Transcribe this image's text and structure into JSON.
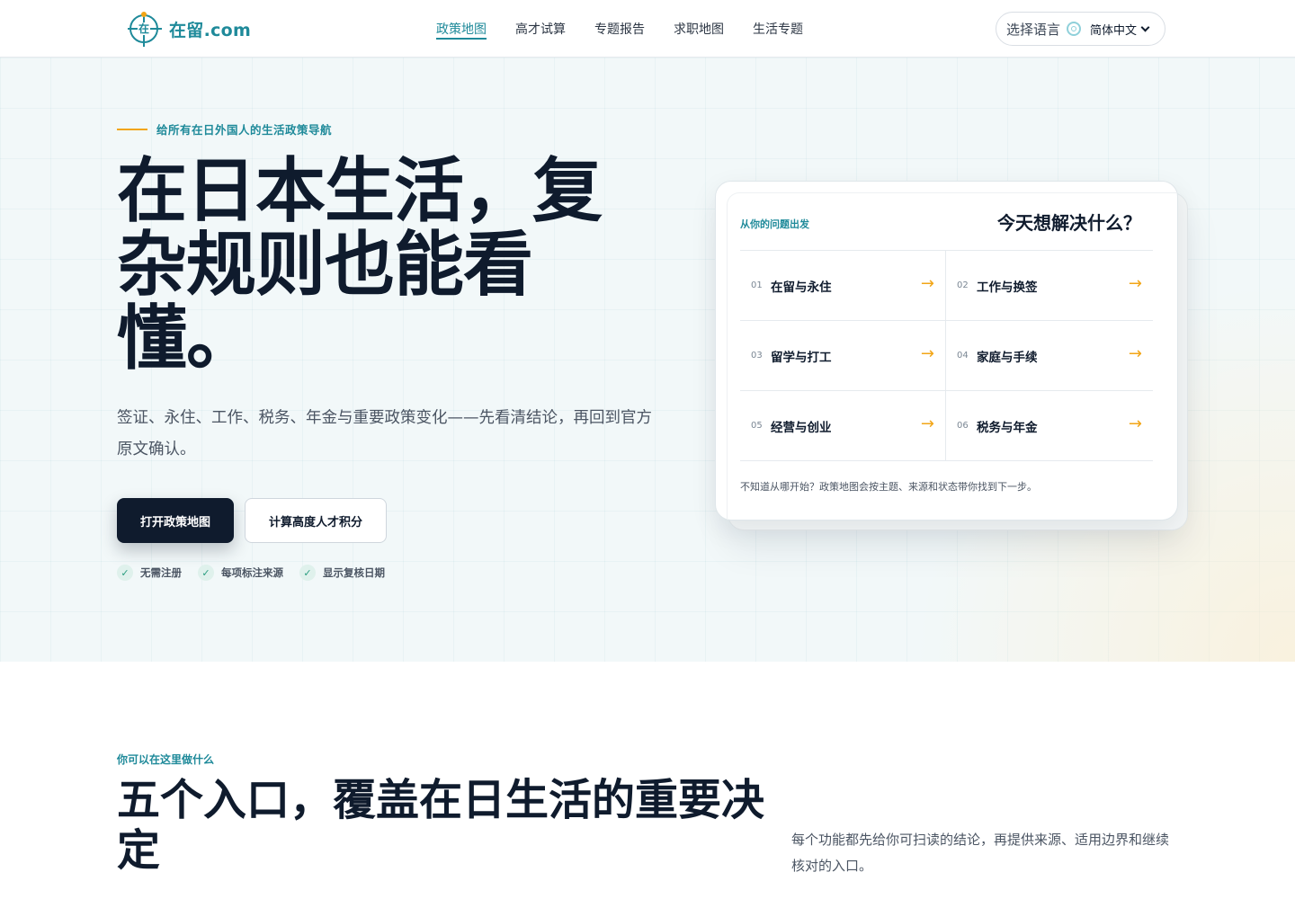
{
  "header": {
    "logo_char": "在",
    "logo_text": "在留.com",
    "nav": [
      {
        "label": "政策地图",
        "active": true
      },
      {
        "label": "高才试算"
      },
      {
        "label": "专题报告"
      },
      {
        "label": "求职地图"
      },
      {
        "label": "生活专题"
      }
    ],
    "language": {
      "label": "选择语言",
      "icon": "globe-icon",
      "selected": "简体中文"
    }
  },
  "hero": {
    "eyebrow": "给所有在日外国人的生活政策导航",
    "title": "在日本生活，复杂规则也能看懂。",
    "subtitle": "签证、永住、工作、税务、年金与重要政策变化——先看清结论，再回到官方原文确认。",
    "primary_button": "打开政策地图",
    "secondary_button": "计算高度人才积分",
    "checks": [
      "无需注册",
      "每项标注来源",
      "显示复核日期"
    ]
  },
  "card": {
    "eyebrow": "从你的问题出发",
    "title": "今天想解决什么？",
    "items": [
      {
        "num": "01",
        "label": "在留与永住"
      },
      {
        "num": "02",
        "label": "工作与换签"
      },
      {
        "num": "03",
        "label": "留学与打工"
      },
      {
        "num": "04",
        "label": "家庭与手续"
      },
      {
        "num": "05",
        "label": "经营与创业"
      },
      {
        "num": "06",
        "label": "税务与年金"
      }
    ],
    "arrow": "→",
    "footnote": "不知道从哪开始？政策地图会按主题、来源和状态带你找到下一步。"
  },
  "section2": {
    "eyebrow": "你可以在这里做什么",
    "title": "五个入口，覆盖在日生活的重要决定",
    "description": "每个功能都先给你可扫读的结论，再提供来源、适用边界和继续核对的入口。"
  },
  "colors": {
    "brand": "#1f8a9a",
    "accent": "#f2a516",
    "ink": "#0f1b2d"
  }
}
